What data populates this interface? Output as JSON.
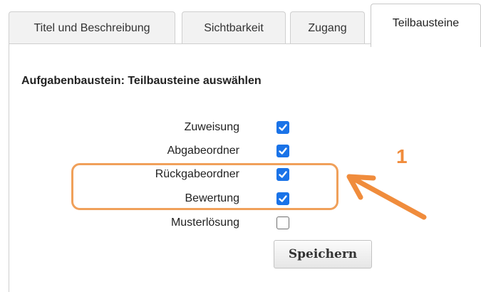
{
  "tabs": [
    {
      "label": "Titel und Beschreibung"
    },
    {
      "label": "Sichtbarkeit"
    },
    {
      "label": "Zugang"
    },
    {
      "label": "Teilbausteine"
    }
  ],
  "active_tab": "Teilbausteine",
  "panel": {
    "heading": "Aufgabenbaustein: Teilbausteine auswählen",
    "options": [
      {
        "label": "Zuweisung",
        "checked": true
      },
      {
        "label": "Abgabeordner",
        "checked": true
      },
      {
        "label": "Rückgabeordner",
        "checked": true
      },
      {
        "label": "Bewertung",
        "checked": true
      },
      {
        "label": "Musterlösung",
        "checked": false
      }
    ],
    "save_label": "Speichern"
  },
  "annotation": {
    "number": "1",
    "color": "#f08c3c"
  },
  "colors": {
    "checkbox_checked": "#1a73e8",
    "highlight": "#f0a05a"
  }
}
